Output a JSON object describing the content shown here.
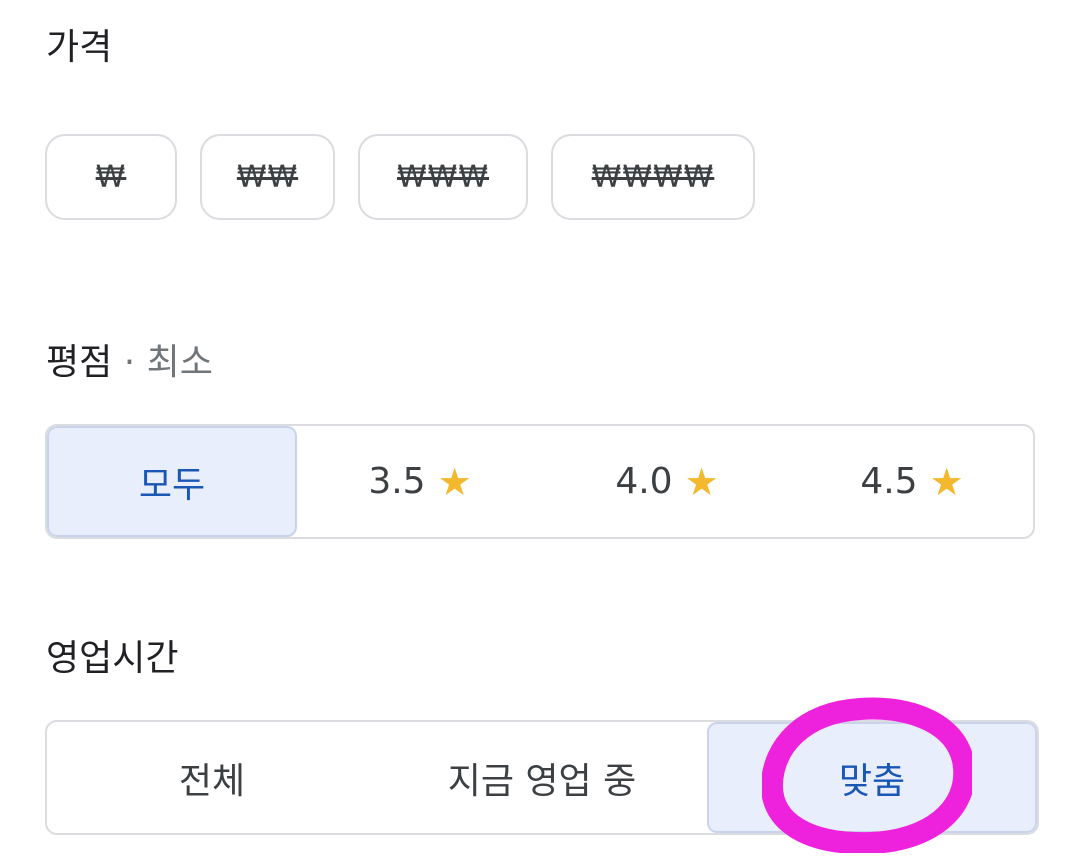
{
  "price": {
    "title": "가격",
    "options": [
      "₩",
      "₩₩",
      "₩₩₩",
      "₩₩₩₩"
    ]
  },
  "rating": {
    "title": "평점",
    "subtitle": " · 최소",
    "options": [
      {
        "label": "모두",
        "selected": true
      },
      {
        "label": "3.5",
        "icon": "star-icon",
        "selected": false
      },
      {
        "label": "4.0",
        "icon": "star-icon",
        "selected": false
      },
      {
        "label": "4.5",
        "icon": "star-icon",
        "selected": false
      }
    ]
  },
  "hours": {
    "title": "영업시간",
    "options": [
      {
        "label": "전체",
        "selected": false
      },
      {
        "label": "지금 영업 중",
        "selected": false
      },
      {
        "label": "맞춤",
        "selected": true
      }
    ]
  },
  "colors": {
    "selected_bg": "#e8eefc",
    "selected_text": "#1a57b5",
    "star": "#f3b82d",
    "annotation": "#ee22dd"
  },
  "annotation": {
    "shape": "circle",
    "target": "hours-option-custom"
  }
}
